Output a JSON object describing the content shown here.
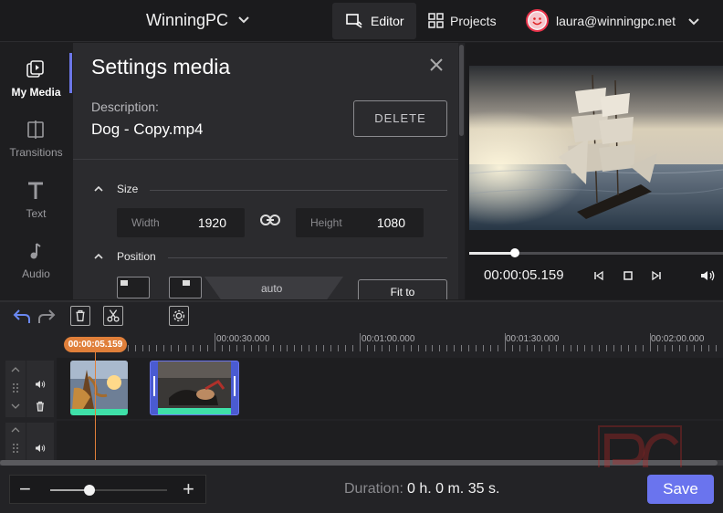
{
  "topbar": {
    "app_title": "WinningPC",
    "editor_label": "Editor",
    "projects_label": "Projects",
    "user_email": "laura@winningpc.net"
  },
  "leftnav": {
    "items": [
      {
        "label": "My Media",
        "icon": "media-icon",
        "active": true
      },
      {
        "label": "Transitions",
        "icon": "transitions-icon",
        "active": false
      },
      {
        "label": "Text",
        "icon": "text-icon",
        "active": false
      },
      {
        "label": "Audio",
        "icon": "music-note-icon",
        "active": false
      }
    ]
  },
  "settings": {
    "title": "Settings media",
    "description_label": "Description:",
    "description_value": "Dog - Copy.mp4",
    "delete_label": "DELETE",
    "size_section": "Size",
    "width_label": "Width",
    "width_value": "1920",
    "height_label": "Height",
    "height_value": "1080",
    "position_section": "Position",
    "auto_label": "auto",
    "fit_label": "Fit to"
  },
  "preview": {
    "time": "00:00:05.159",
    "progress": 0.17
  },
  "timeline": {
    "playhead_time": "00:00:05.159",
    "ticks": [
      "00:00:30.000",
      "00:01:00.000",
      "00:01:30.000",
      "00:02:00.000"
    ]
  },
  "bottombar": {
    "zoom_minus": "−",
    "zoom_plus": "+",
    "zoom_level": 0.3,
    "duration_label": "Duration:",
    "duration_value": "0 h. 0 m. 35 s.",
    "save_label": "Save"
  },
  "colors": {
    "accent": "#6a74ee",
    "playhead": "#e07f3a",
    "clip_bar": "#3fe0a8"
  }
}
